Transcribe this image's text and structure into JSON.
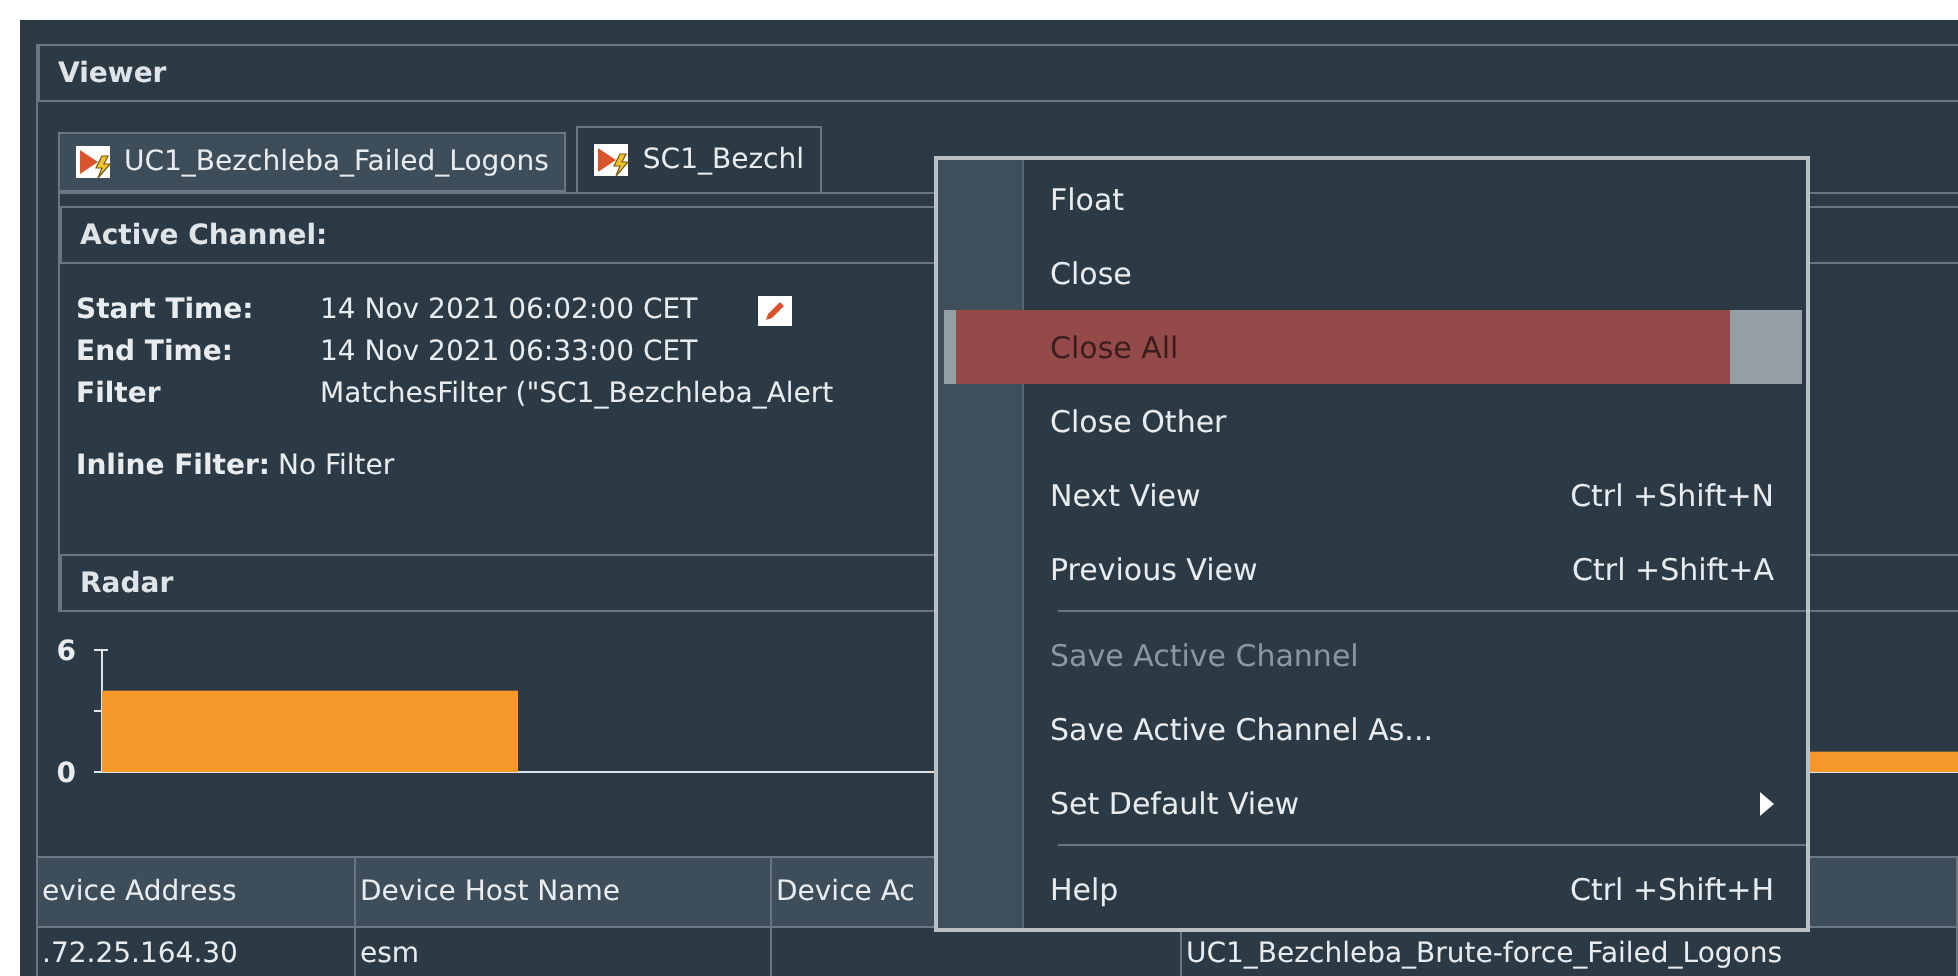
{
  "viewer": {
    "title": "Viewer"
  },
  "tabs": [
    {
      "label": "UC1_Bezchleba_Failed_Logons",
      "selected": false
    },
    {
      "label": "SC1_Bezchl",
      "selected": true
    }
  ],
  "active_channel": {
    "title": "Active Channel:",
    "fields": [
      {
        "label": "Start Time:",
        "value": "14 Nov 2021 06:02:00 CET",
        "editable": true
      },
      {
        "label": "End Time:",
        "value": "14 Nov 2021 06:33:00 CET",
        "editable": false
      },
      {
        "label": "Filter",
        "value": "MatchesFilter (\"SC1_Bezchleba_Alert",
        "editable": false
      }
    ],
    "inline_filter": {
      "label": "Inline Filter:",
      "value": "No Filter"
    }
  },
  "radar": {
    "title": "Radar",
    "chart_data": {
      "type": "bar",
      "yticks": [
        0,
        6
      ],
      "ylim": [
        0,
        6
      ],
      "series": [
        {
          "color": "#f7992a",
          "values": [
            4,
            0,
            null,
            null,
            1
          ]
        }
      ]
    }
  },
  "table": {
    "columns": [
      "evice Address",
      "Device Host Name",
      "Device Ac",
      null
    ],
    "rows": [
      [
        ".72.25.164.30",
        "esm",
        "",
        "UC1_Bezchleba_Brute-force_Failed_Logons"
      ]
    ]
  },
  "context_menu": [
    {
      "kind": "item",
      "label": "Float",
      "selected": false,
      "disabled": false
    },
    {
      "kind": "item",
      "label": "Close",
      "selected": false,
      "disabled": false
    },
    {
      "kind": "item",
      "label": "Close All",
      "selected": true,
      "disabled": false
    },
    {
      "kind": "item",
      "label": "Close Other",
      "selected": false,
      "disabled": false
    },
    {
      "kind": "item",
      "label": "Next View",
      "shortcut": "Ctrl +Shift+N",
      "selected": false,
      "disabled": false
    },
    {
      "kind": "item",
      "label": "Previous View",
      "shortcut": "Ctrl +Shift+A",
      "selected": false,
      "disabled": false
    },
    {
      "kind": "separator"
    },
    {
      "kind": "item",
      "label": "Save Active Channel",
      "selected": false,
      "disabled": true
    },
    {
      "kind": "item",
      "label": "Save Active Channel As...",
      "selected": false,
      "disabled": false
    },
    {
      "kind": "submenu",
      "label": "Set Default View",
      "selected": false,
      "disabled": false
    },
    {
      "kind": "separator"
    },
    {
      "kind": "item",
      "label": "Help",
      "shortcut": "Ctrl +Shift+H",
      "selected": false,
      "disabled": false
    }
  ]
}
